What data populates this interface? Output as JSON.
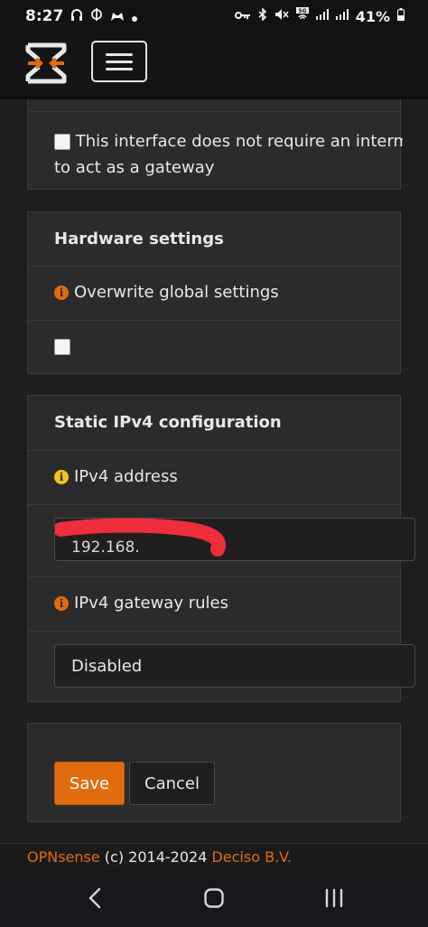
{
  "status_bar": {
    "time": "8:27",
    "notification_icons": [
      "headset-icon",
      "theta-icon",
      "game-icon",
      "dot-icon"
    ],
    "system_icons": [
      "key-icon",
      "bluetooth-icon",
      "mute-icon",
      "wifi-5g-icon",
      "signal-icon",
      "signal-icon"
    ],
    "battery": "41%"
  },
  "header": {
    "logo": "opnsense-logo",
    "menu_icon": "hamburger-icon"
  },
  "gateway_card": {
    "checkbox_label_line1": "This interface does not require an intermed",
    "checkbox_label_line2": "to act as a gateway",
    "checked": false
  },
  "hardware_card": {
    "title": "Hardware settings",
    "overwrite_label": "Overwrite global settings",
    "overwrite_checked": false
  },
  "static_ipv4_card": {
    "title": "Static IPv4 configuration",
    "address_label": "IPv4 address",
    "address_value": "192.168.",
    "gateway_rules_label": "IPv4 gateway rules",
    "gateway_rules_value": "Disabled"
  },
  "actions": {
    "save_label": "Save",
    "cancel_label": "Cancel"
  },
  "footer": {
    "brand": "OPNsense",
    "copyright": " (c) 2014-2024 ",
    "company": "Deciso B.V."
  },
  "colors": {
    "accent": "#e06c0e",
    "info_yellow": "#f0c419",
    "card_bg": "#2b2b2c",
    "page_bg": "#1e1e1f",
    "redaction": "#ee2d3d"
  }
}
